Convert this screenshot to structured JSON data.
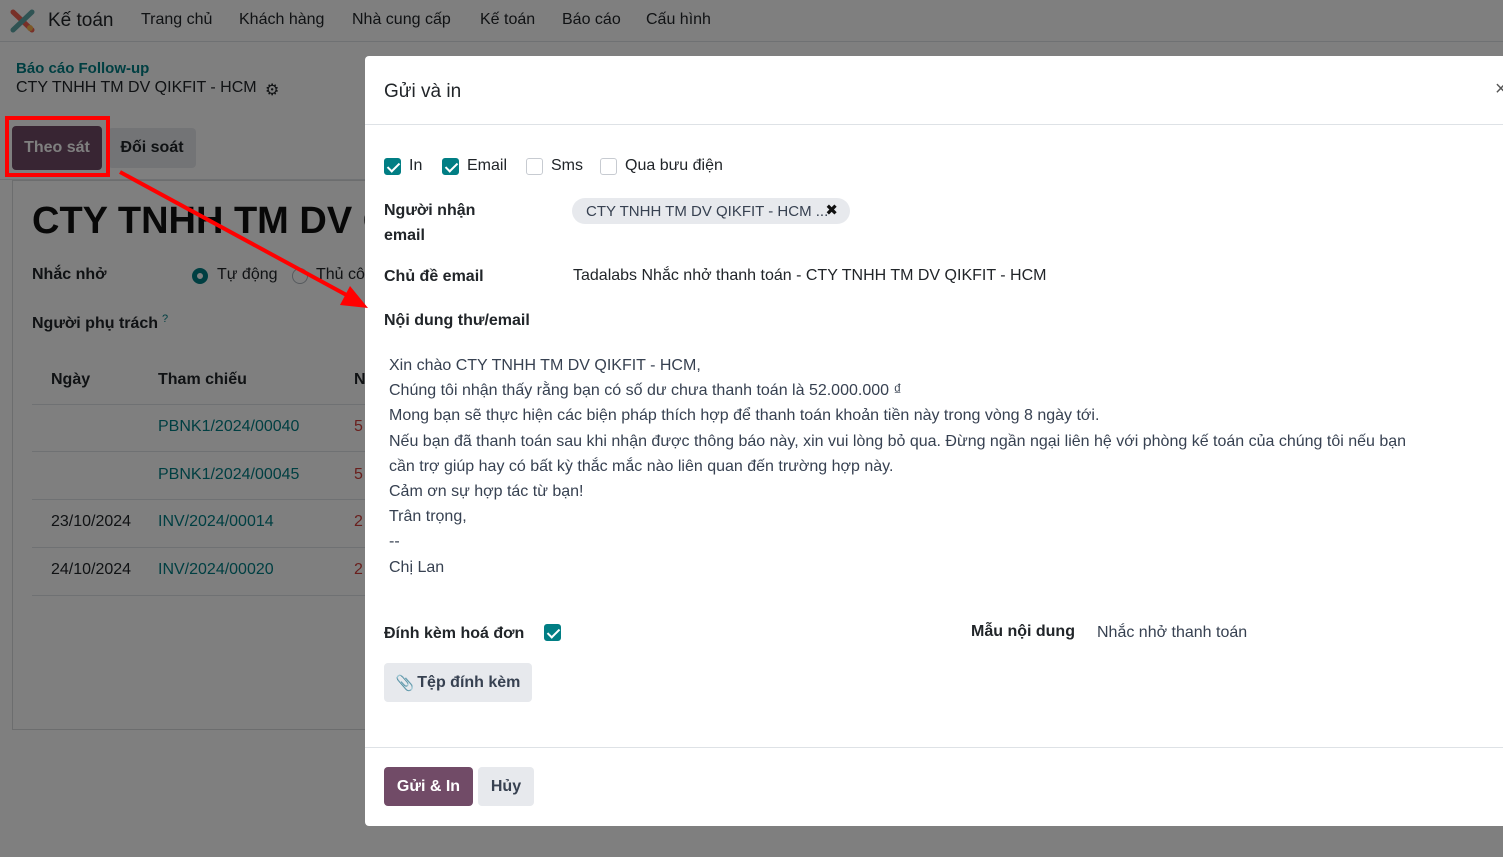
{
  "navbar": {
    "app_name": "Kế toán",
    "items": [
      "Trang chủ",
      "Khách hàng",
      "Nhà cung cấp",
      "Kế toán",
      "Báo cáo",
      "Cấu hình"
    ]
  },
  "breadcrumb": {
    "parent": "Báo cáo Follow-up",
    "current": "CTY TNHH TM DV QIKFIT - HCM"
  },
  "tabs": {
    "follow_up": "Theo sát",
    "reconcile": "Đối soát"
  },
  "partner": {
    "title": "CTY TNHH TM DV QIKFIT - HCM",
    "reminder_label": "Nhắc nhở",
    "reminder_auto": "Tự động",
    "reminder_manual": "Thủ công",
    "responsible_label": "Người phụ trách",
    "help_mark": "?"
  },
  "table": {
    "headers": [
      "Ngày",
      "Tham chiếu",
      "N"
    ],
    "rows": [
      {
        "date": "",
        "ref": "PBNK1/2024/00040",
        "amount": "5"
      },
      {
        "date": "",
        "ref": "PBNK1/2024/00045",
        "amount": "5"
      },
      {
        "date": "23/10/2024",
        "ref": "INV/2024/00014",
        "amount": "2"
      },
      {
        "date": "24/10/2024",
        "ref": "INV/2024/00020",
        "amount": "2"
      }
    ]
  },
  "modal": {
    "title": "Gửi và in",
    "close": "×",
    "options": {
      "print": {
        "label": "In",
        "checked": true
      },
      "email": {
        "label": "Email",
        "checked": true
      },
      "sms": {
        "label": "Sms",
        "checked": false
      },
      "post": {
        "label": "Qua bưu điện",
        "checked": false
      }
    },
    "recipients_label_1": "Người nhận",
    "recipients_label_2": "email",
    "recipient_tag": "CTY TNHH TM DV QIKFIT - HCM ...",
    "recipient_remove": "✖",
    "subject_label": "Chủ đề email",
    "subject_value": "Tadalabs Nhắc nhở thanh toán - CTY TNHH TM DV QIKFIT - HCM",
    "body_label": "Nội dung thư/email",
    "body_lines": [
      "Xin chào CTY TNHH TM DV QIKFIT - HCM,",
      "Chúng tôi nhận thấy rằng bạn có số dư chưa thanh toán là 52.000.000 ₫",
      "Mong bạn sẽ thực hiện các biện pháp thích hợp để thanh toán khoản tiền này trong vòng 8 ngày tới.",
      "Nếu bạn đã thanh toán sau khi nhận được thông báo này, xin vui lòng bỏ qua. Đừng ngần ngại liên hệ với phòng kế toán của chúng tôi nếu bạn",
      "cần trợ giúp hay có bất kỳ thắc mắc nào liên quan đến trường hợp này.",
      "Cảm ơn sự hợp tác từ bạn!",
      "Trân trọng,",
      "--",
      "Chị Lan"
    ],
    "attach_invoice_label": "Đính kèm hoá đơn",
    "attach_invoice_checked": true,
    "template_label": "Mẫu nội dung",
    "template_value": "Nhắc nhở thanh toán",
    "attachments_button": "Tệp đính kèm",
    "send_button": "Gửi & In",
    "cancel_button": "Hủy"
  },
  "colors": {
    "primary": "#714b67",
    "accent": "#017e84",
    "annotation": "#ff0000"
  }
}
